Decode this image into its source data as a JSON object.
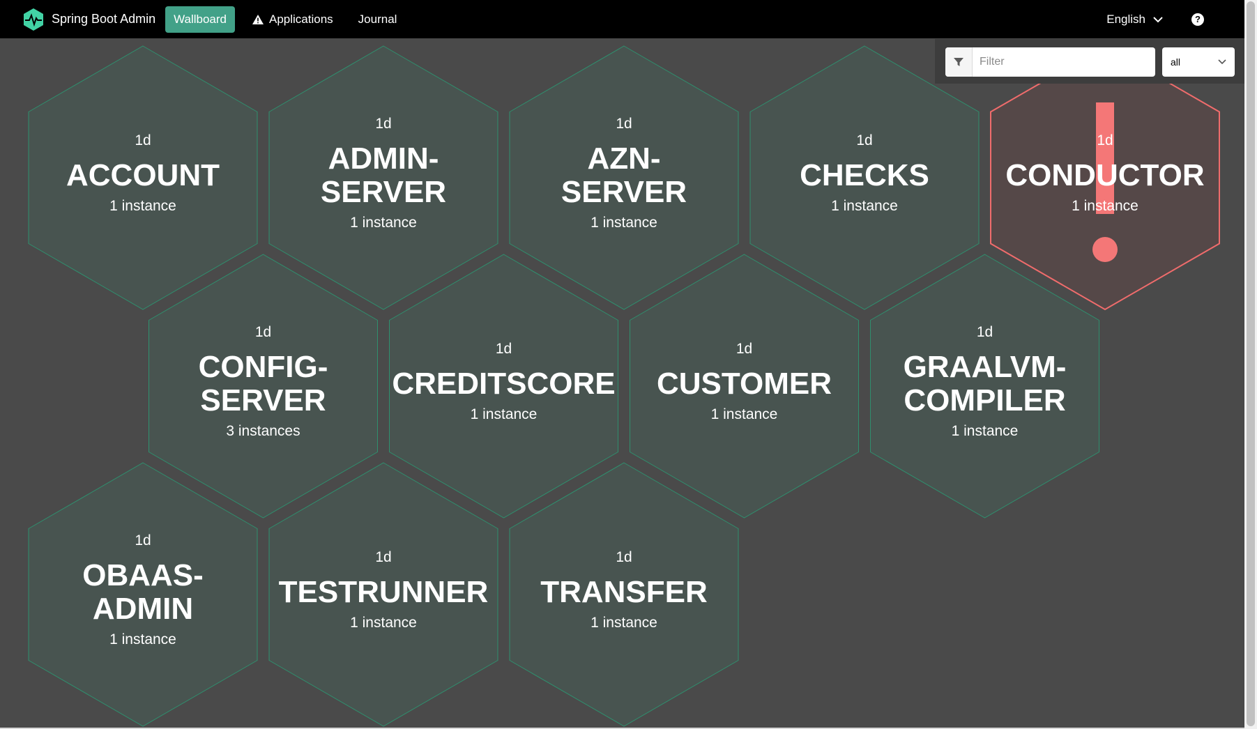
{
  "header": {
    "brand": "Spring Boot Admin",
    "nav": [
      {
        "label": "Wallboard",
        "active": true
      },
      {
        "label": "Applications",
        "icon": "warning-icon"
      },
      {
        "label": "Journal"
      }
    ],
    "language": "English",
    "help": "?"
  },
  "filter": {
    "placeholder": "Filter",
    "status_value": "all"
  },
  "colors": {
    "accent": "#42a188",
    "tile_fill": "#485450",
    "tile_stroke": "#2f8f6e",
    "down_fill": "#554848",
    "down_stroke": "#f06c6c",
    "down_mark": "#f47777",
    "background": "#4a4a4a"
  },
  "applications": [
    {
      "name": [
        "ACCOUNT"
      ],
      "uptime": "1d",
      "instances": "1 instance",
      "status": "up"
    },
    {
      "name": [
        "ADMIN-",
        "SERVER"
      ],
      "uptime": "1d",
      "instances": "1 instance",
      "status": "up"
    },
    {
      "name": [
        "AZN-",
        "SERVER"
      ],
      "uptime": "1d",
      "instances": "1 instance",
      "status": "up"
    },
    {
      "name": [
        "CHECKS"
      ],
      "uptime": "1d",
      "instances": "1 instance",
      "status": "up"
    },
    {
      "name": [
        "CONDUCTOR"
      ],
      "uptime": "1d",
      "instances": "1 instance",
      "status": "down"
    },
    {
      "name": [
        "CONFIG-",
        "SERVER"
      ],
      "uptime": "1d",
      "instances": "3 instances",
      "status": "up"
    },
    {
      "name": [
        "CREDITSCORE"
      ],
      "uptime": "1d",
      "instances": "1 instance",
      "status": "up"
    },
    {
      "name": [
        "CUSTOMER"
      ],
      "uptime": "1d",
      "instances": "1 instance",
      "status": "up"
    },
    {
      "name": [
        "GRAALVM-",
        "COMPILER"
      ],
      "uptime": "1d",
      "instances": "1 instance",
      "status": "up"
    },
    {
      "name": [
        "OBAAS-",
        "ADMIN"
      ],
      "uptime": "1d",
      "instances": "1 instance",
      "status": "up"
    },
    {
      "name": [
        "TESTRUNNER"
      ],
      "uptime": "1d",
      "instances": "1 instance",
      "status": "up"
    },
    {
      "name": [
        "TRANSFER"
      ],
      "uptime": "1d",
      "instances": "1 instance",
      "status": "up"
    }
  ]
}
